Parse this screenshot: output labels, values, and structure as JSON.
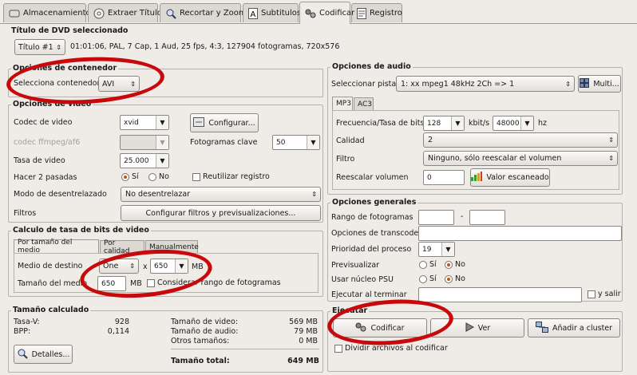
{
  "tabs": [
    {
      "label": "Almacenamiento",
      "icon": "drive-icon"
    },
    {
      "label": "Extraer Título",
      "icon": "disc-icon"
    },
    {
      "label": "Recortar y Zoom",
      "icon": "zoom-icon"
    },
    {
      "label": "Subtitulos",
      "icon": "text-icon"
    },
    {
      "label": "Codificar",
      "icon": "gears-icon"
    },
    {
      "label": "Registro",
      "icon": "log-icon"
    }
  ],
  "dvd": {
    "section_title": "Título de DVD seleccionado",
    "title_value": "Título #1",
    "title_info": "01:01:06, PAL, 7 Cap, 1 Aud, 25 fps, 4:3, 127904 fotogramas, 720x576"
  },
  "container": {
    "section_title": "Opciones de contenedor",
    "label": "Selecciona contenedor",
    "value": "AVI"
  },
  "video": {
    "section_title": "Opciones de video",
    "codec_label": "Codec de video",
    "codec_value": "xvid",
    "configure_button": "Configurar...",
    "ffmpeg_label": "codec ffmpeg/af6",
    "keyframes_label": "Fotogramas clave",
    "keyframes_value": "50",
    "rate_label": "Tasa de video",
    "rate_value": "25.000",
    "two_pass_label": "Hacer 2 pasadas",
    "yes": "Sí",
    "no": "No",
    "reuse_log": "Reutilizar registro",
    "deinterlace_label": "Modo de desentrelazado",
    "deinterlace_value": "No desentrelazar",
    "filters_label": "Filtros",
    "filters_button": "Configurar filtros y previsualizaciones..."
  },
  "bitrate": {
    "section_title": "Calculo de tasa de bits de video",
    "tabs": [
      "Por tamaño del medio",
      "Por calidad",
      "Manualmente"
    ],
    "media_dest_label": "Medio de destino",
    "media_count": "One",
    "x": "x",
    "media_size": "650",
    "mb": "MB",
    "media_size_label": "Tamaño del medio",
    "media_size_value": "650",
    "consider_range": "Considerar rango de fotogramas"
  },
  "calc": {
    "section_title": "Tamaño calculado",
    "tasa_v_label": "Tasa-V:",
    "tasa_v_value": "928",
    "bpp_label": "BPP:",
    "bpp_value": "0,114",
    "details_button": "Detalles...",
    "video_size_label": "Tamaño de video:",
    "video_size_value": "569 MB",
    "audio_size_label": "Tamaño de audio:",
    "audio_size_value": "79 MB",
    "other_label": "Otros tamaños:",
    "other_value": "0 MB",
    "total_label": "Tamaño total:",
    "total_value": "649 MB"
  },
  "audio": {
    "section_title": "Opciones de audio",
    "track_label": "Seleccionar pista",
    "track_value": "1: xx mpeg1 48kHz 2Ch => 1",
    "multi_button": "Multi...",
    "tabs": [
      "MP3",
      "AC3"
    ],
    "freq_label": "Frecuencia/Tasa de bits",
    "bitrate_value": "128",
    "kbits": "kbit/s",
    "freq_value": "48000",
    "hz": "hz",
    "quality_label": "Calidad",
    "quality_value": "2",
    "filter_label": "Filtro",
    "filter_value": "Ninguno, sólo reescalar el volumen",
    "rescale_label": "Reescalar volumen",
    "rescale_value": "0",
    "scanned_button": "Valor escaneado"
  },
  "general": {
    "section_title": "Opciones generales",
    "frame_range_label": "Rango de fotogramas",
    "dash": "-",
    "transcode_label": "Opciones de transcode",
    "priority_label": "Prioridad del proceso",
    "priority_value": "19",
    "preview_label": "Previsualizar",
    "psu_label": "Usar núcleo PSU",
    "yes": "Sí",
    "no": "No",
    "run_end_label": "Ejecutar al terminar",
    "and_exit": "y salir"
  },
  "execute": {
    "section_title": "Ejecutar",
    "encode_button": "Codificar",
    "view_button": "Ver",
    "cluster_button": "Añadir a cluster",
    "split_files": "Dividir archivos al codificar"
  },
  "colors": {
    "annotation": "#c8090c",
    "radio_selected": "#c0541a"
  }
}
